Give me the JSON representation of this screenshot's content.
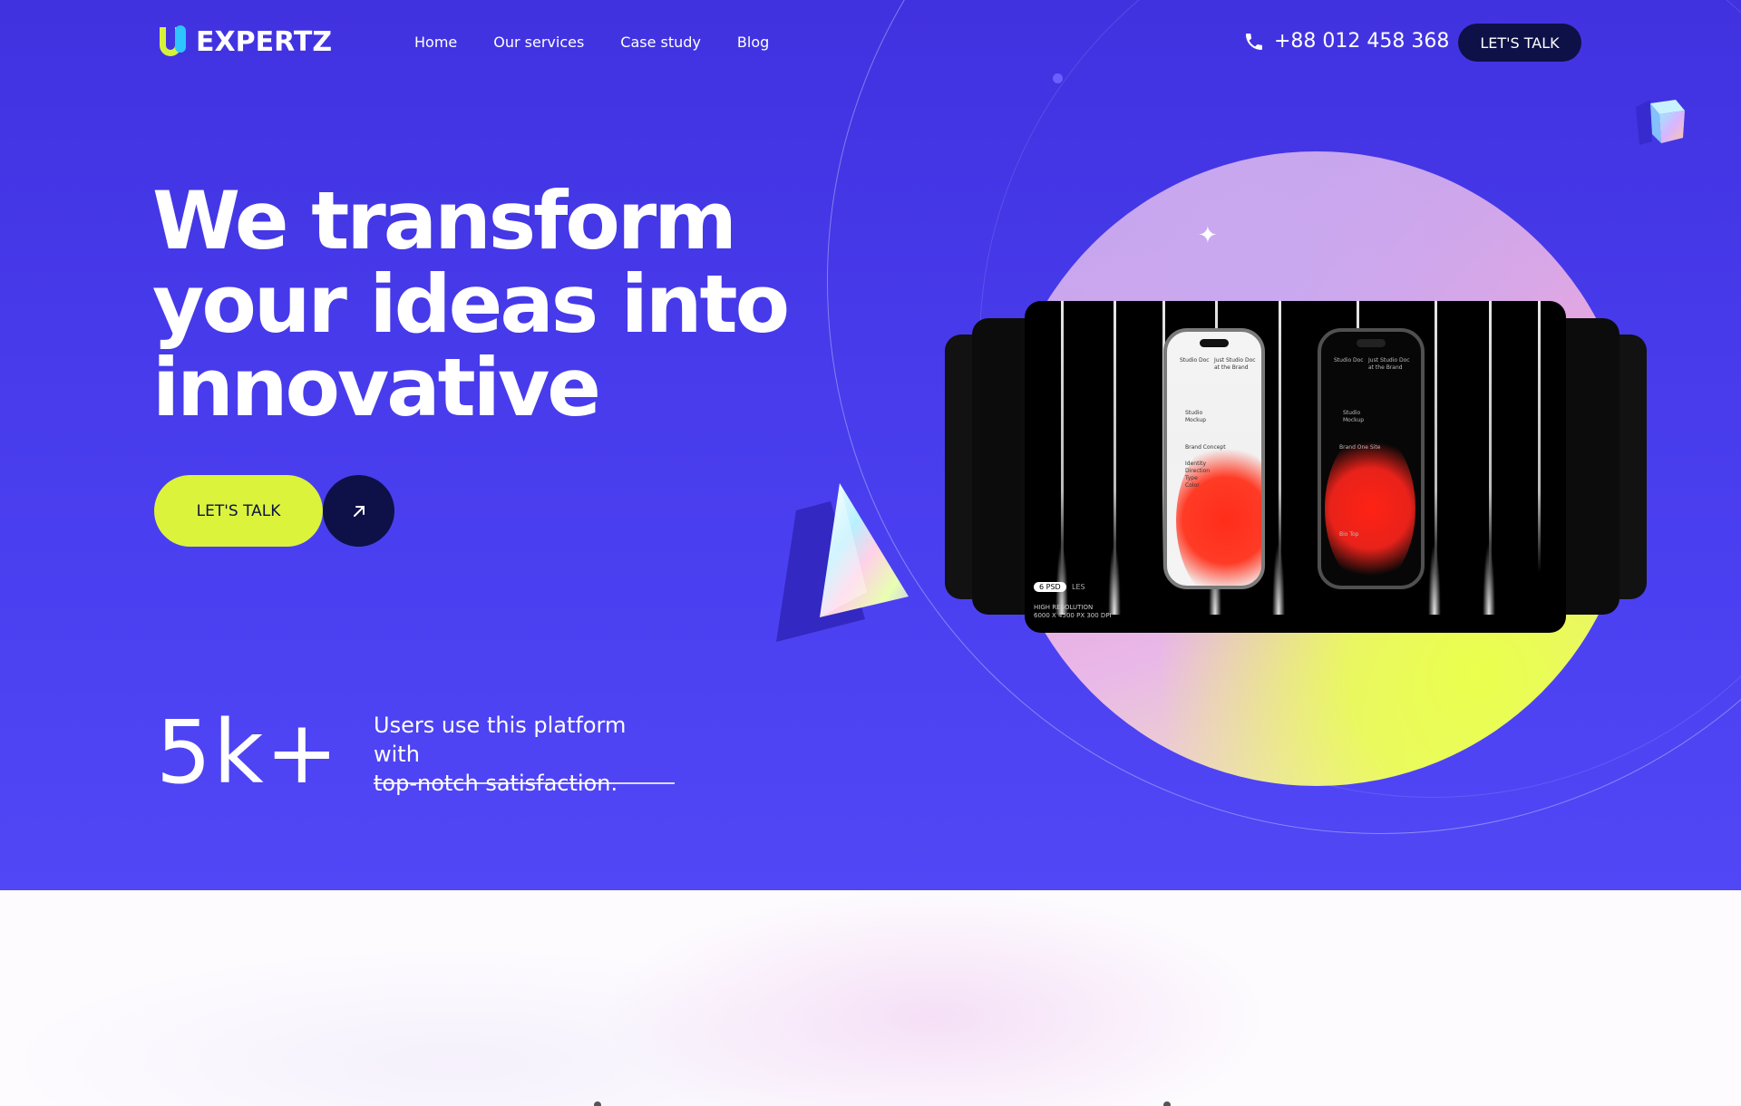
{
  "brand": {
    "name": "EXPERTZ",
    "logo_icon": "u-logo-icon"
  },
  "nav": {
    "items": [
      "Home",
      "Our services",
      "Case study",
      "Blog"
    ]
  },
  "contact": {
    "phone": "+88 012 458 368",
    "phone_icon": "phone-icon"
  },
  "header_cta": {
    "label": "LET'S TALK"
  },
  "hero": {
    "headline_lines": [
      "We transform",
      "your ideas into",
      "innovative"
    ],
    "cta_label": "LET'S TALK",
    "cta_icon": "arrow-up-right-icon"
  },
  "stat": {
    "value": "5k+",
    "description_line1": "Users use this platform with",
    "description_line2": "top-notch satisfaction."
  },
  "showcase": {
    "badge": "6 PSD",
    "badge_suffix": "LES",
    "resolution_line1": "HIGH RESOLUTION",
    "resolution_line2": "6000 X 4500 PX 300 DPI"
  },
  "colors": {
    "hero_bg": "#4132e0",
    "accent_lime": "#dbf43b",
    "navy": "#0d1147",
    "orb_yellow": "#eaff4d"
  }
}
